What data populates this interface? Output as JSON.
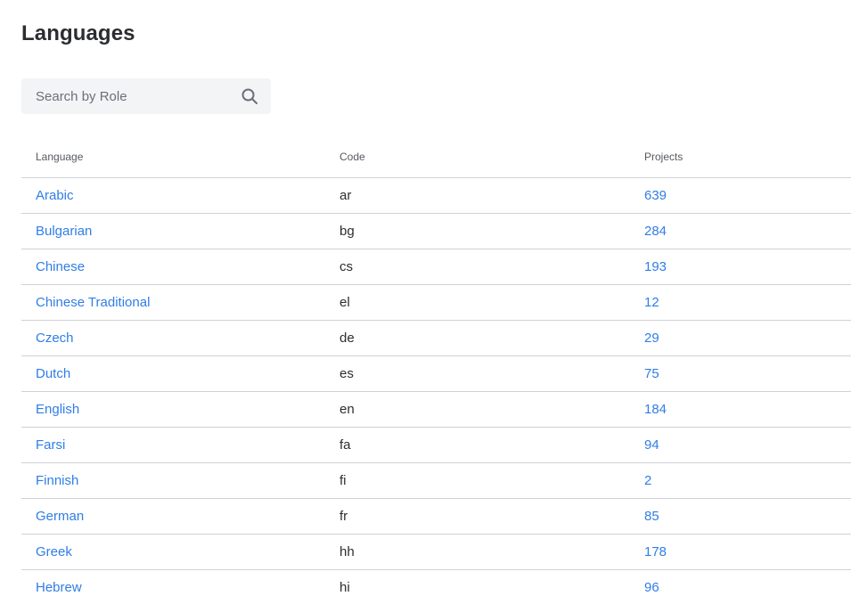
{
  "title": "Languages",
  "search": {
    "placeholder": "Search by Role",
    "value": ""
  },
  "table": {
    "headers": {
      "language": "Language",
      "code": "Code",
      "projects": "Projects"
    },
    "rows": [
      {
        "language": "Arabic",
        "code": "ar",
        "projects": "639"
      },
      {
        "language": "Bulgarian",
        "code": "bg",
        "projects": "284"
      },
      {
        "language": "Chinese",
        "code": "cs",
        "projects": "193"
      },
      {
        "language": "Chinese Traditional",
        "code": "el",
        "projects": "12"
      },
      {
        "language": "Czech",
        "code": "de",
        "projects": "29"
      },
      {
        "language": "Dutch",
        "code": "es",
        "projects": "75"
      },
      {
        "language": "English",
        "code": "en",
        "projects": "184"
      },
      {
        "language": "Farsi",
        "code": "fa",
        "projects": "94"
      },
      {
        "language": "Finnish",
        "code": "fi",
        "projects": "2"
      },
      {
        "language": "German",
        "code": "fr",
        "projects": "85"
      },
      {
        "language": "Greek",
        "code": "hh",
        "projects": "178"
      },
      {
        "language": "Hebrew",
        "code": "hi",
        "projects": "96"
      }
    ]
  },
  "icons": {
    "search": "search-icon"
  },
  "colors": {
    "link": "#2f7ee6",
    "text": "#2b2d31",
    "search_bg": "#f3f4f6",
    "divider": "#cfd1d6"
  }
}
